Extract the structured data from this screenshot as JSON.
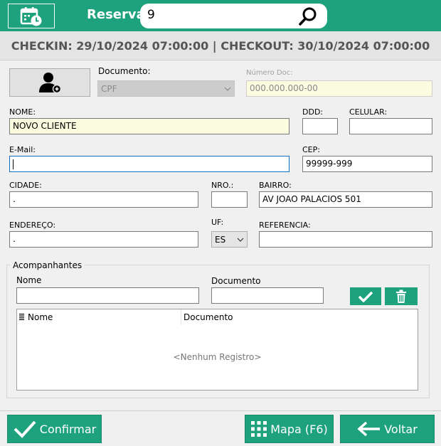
{
  "colors": {
    "primary": "#1ea27d",
    "input_yellow": "#fbfbdf",
    "focus_border": "#0f6fc6"
  },
  "header": {
    "reserva_label": "Reserva",
    "search_value": "9",
    "calendar_icon": "calendar-clock-icon",
    "search_icon": "magnifier-icon"
  },
  "checkbar": {
    "text": "CHECKIN: 29/10/2024 07:00:00 | CHECKOUT: 30/10/2024 07:00:00"
  },
  "form": {
    "user_icon": "add-user-icon",
    "documento_label": "Documento:",
    "documento_value": "CPF",
    "numero_doc_label": "Número Doc:",
    "numero_doc_value": "000.000.000-00",
    "nome_label": "NOME:",
    "nome_value": "NOVO CLIENTE",
    "ddd_label": "DDD:",
    "ddd_value": "",
    "celular_label": "CELULAR:",
    "celular_value": "",
    "email_label": "E-Mail:",
    "email_value": "",
    "cep_label": "CEP:",
    "cep_value": "99999-999",
    "cidade_label": "CIDADE:",
    "cidade_value": ".",
    "nro_label": "NRO.:",
    "nro_value": "",
    "bairro_label": "BAIRRO:",
    "bairro_value": "AV JOAO  PALACIOS 501",
    "endereco_label": "ENDEREÇO:",
    "endereco_value": ".",
    "uf_label": "UF:",
    "uf_value": "ES",
    "referencia_label": "REFERENCIA:",
    "referencia_value": ""
  },
  "companions": {
    "title": "Acompanhantes",
    "nome_label": "Nome",
    "nome_value": "",
    "documento_label": "Documento",
    "documento_value": "",
    "confirm_icon": "check-icon",
    "delete_icon": "trash-icon",
    "grid": {
      "columns": [
        "Nome",
        "Documento"
      ],
      "empty_text": "<Nenhum Registro>"
    }
  },
  "footer": {
    "confirmar_label": "Confirmar",
    "mapa_label": "Mapa (F6)",
    "voltar_label": "Voltar"
  }
}
